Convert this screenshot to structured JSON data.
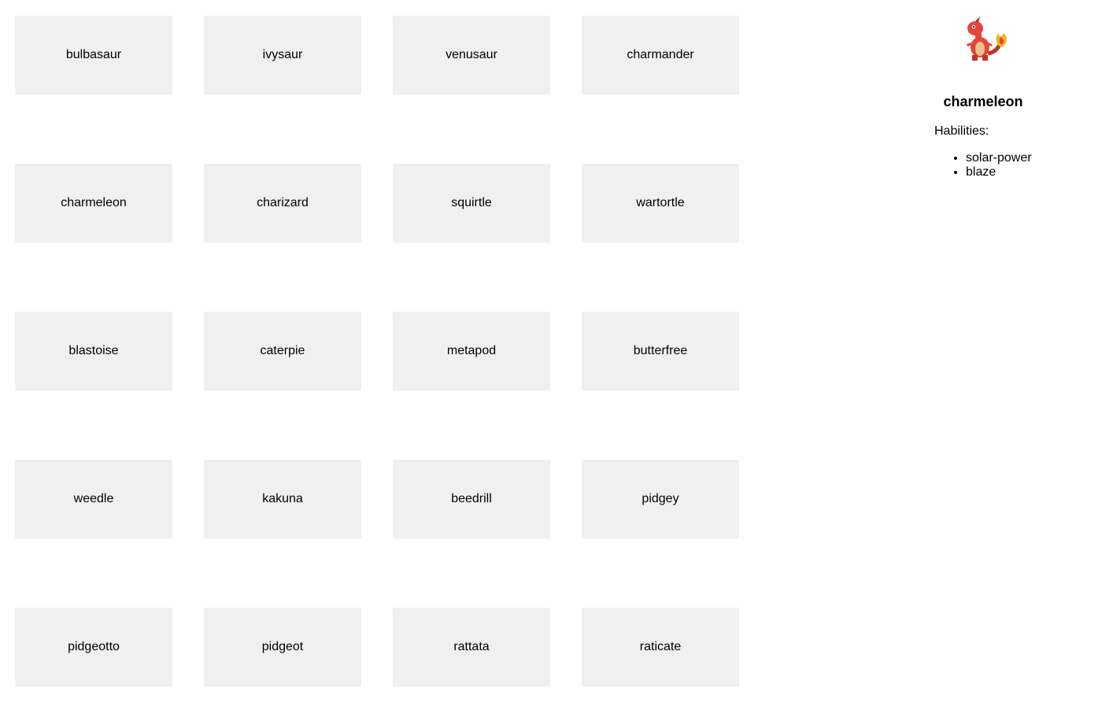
{
  "pokemon_list": [
    "bulbasaur",
    "ivysaur",
    "venusaur",
    "charmander",
    "charmeleon",
    "charizard",
    "squirtle",
    "wartortle",
    "blastoise",
    "caterpie",
    "metapod",
    "butterfree",
    "weedle",
    "kakuna",
    "beedrill",
    "pidgey",
    "pidgeotto",
    "pidgeot",
    "rattata",
    "raticate"
  ],
  "detail": {
    "sprite_icon": "charmeleon-sprite-icon",
    "name": "charmeleon",
    "abilities_label": "Habilities:",
    "abilities": [
      "solar-power",
      "blaze"
    ]
  },
  "colors": {
    "card_bg": "#f0f0f0",
    "sprite_body": "#e3463b",
    "sprite_belly": "#e8c48a",
    "sprite_flame": "#f7b21c"
  }
}
